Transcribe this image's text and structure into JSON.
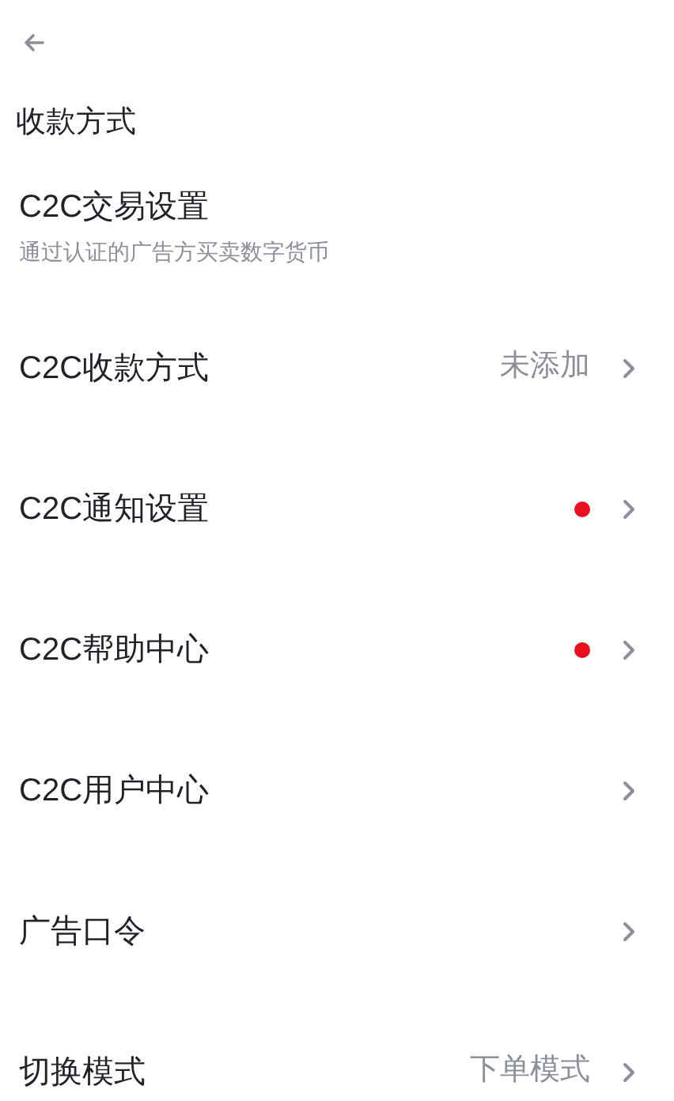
{
  "header": {
    "title": "收款方式"
  },
  "items": [
    {
      "kind": "section",
      "title": "C2C交易设置",
      "subtitle": "通过认证的广告方买卖数字货币"
    },
    {
      "kind": "link",
      "title": "C2C收款方式",
      "value": "未添加",
      "dot": false
    },
    {
      "kind": "link",
      "title": "C2C通知设置",
      "dot": true
    },
    {
      "kind": "link",
      "title": "C2C帮助中心",
      "dot": true
    },
    {
      "kind": "link",
      "title": "C2C用户中心",
      "dot": false
    },
    {
      "kind": "link",
      "title": "广告口令",
      "dot": false
    },
    {
      "kind": "link",
      "title": "切换模式",
      "value": "下单模式",
      "dot": false
    }
  ]
}
